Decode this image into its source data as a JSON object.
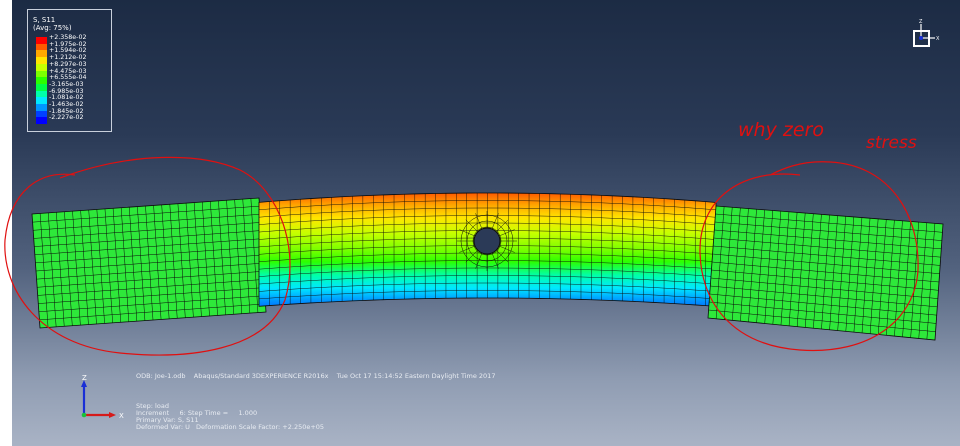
{
  "legend": {
    "title": "S, S11",
    "subtitle": "(Avg: 75%)",
    "entries": [
      {
        "value": "+2.358e-02",
        "color": "#ff0000"
      },
      {
        "value": "+1.975e-02",
        "color": "#ff5a00"
      },
      {
        "value": "+1.594e-02",
        "color": "#ffa800"
      },
      {
        "value": "+1.212e-02",
        "color": "#ffe500"
      },
      {
        "value": "+8.297e-03",
        "color": "#c7ff00"
      },
      {
        "value": "+4.475e-03",
        "color": "#7cff00"
      },
      {
        "value": "+6.555e-04",
        "color": "#2cff00"
      },
      {
        "value": "-3.165e-03",
        "color": "#00ff45"
      },
      {
        "value": "-6.985e-03",
        "color": "#00ffaa"
      },
      {
        "value": "-1.081e-02",
        "color": "#00e8ff"
      },
      {
        "value": "-1.463e-02",
        "color": "#0096ff"
      },
      {
        "value": "-1.845e-02",
        "color": "#0040ff"
      },
      {
        "value": "-2.227e-02",
        "color": "#0000ff"
      }
    ]
  },
  "info": {
    "odb_line": "ODB: Joe-1.odb    Abaqus/Standard 3DEXPERIENCE R2016x    Tue Oct 17 15:14:52 Eastern Daylight Time 2017",
    "step": "Step: load",
    "increment": "Increment     6: Step Time =     1.000",
    "primary_var": "Primary Var: S, S11",
    "deformed_var": "Deformed Var: U   Deformation Scale Factor: +2.250e+05"
  },
  "triad": {
    "x_label": "X",
    "y_label": "Y",
    "z_label": "Z"
  },
  "viewcube": {
    "z_label": "Z",
    "x_label": "X"
  },
  "annotation": {
    "line1": "why zero",
    "line2": "stress",
    "color": "#e01010"
  },
  "colors": {
    "mesh_line": "#0a0a0a",
    "zero_green": "#2ee83a",
    "bg_top": "#1c2b44",
    "bg_bottom": "#a9b3c5"
  }
}
